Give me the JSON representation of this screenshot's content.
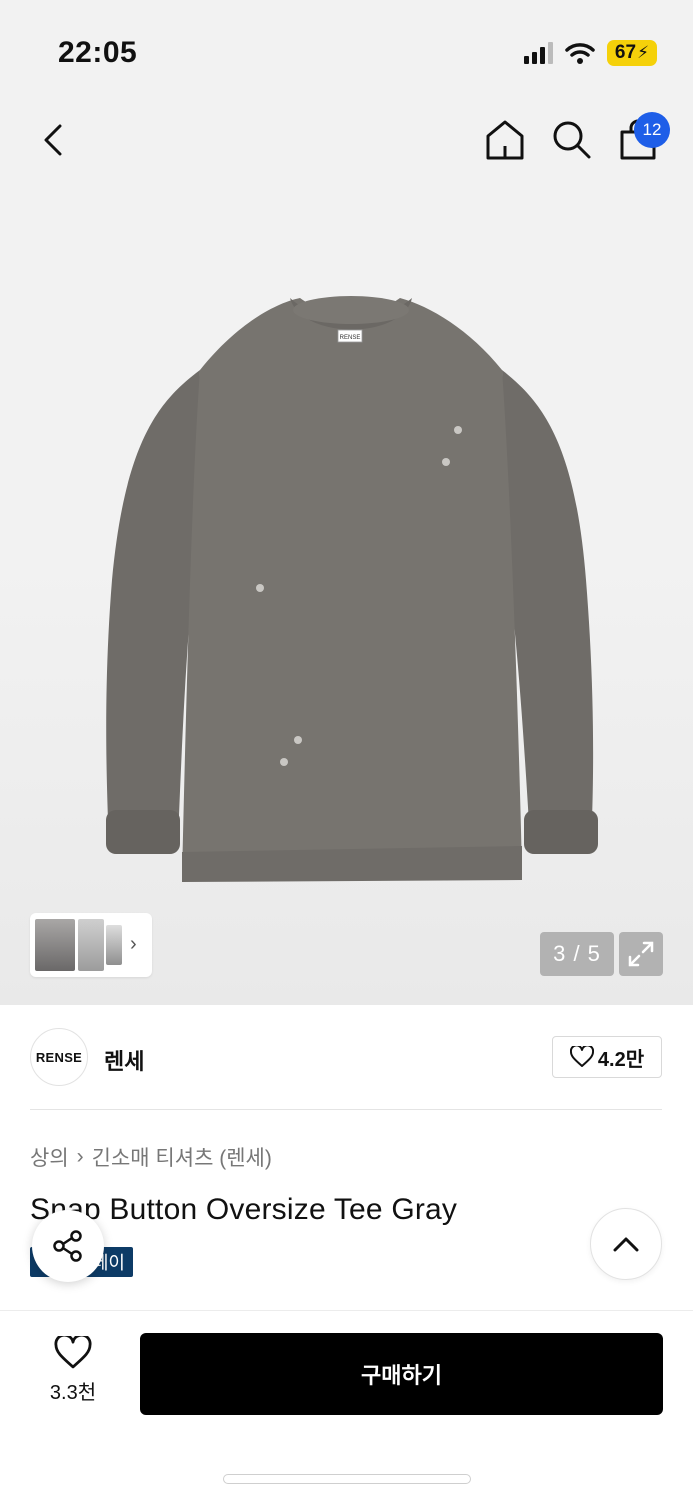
{
  "status_bar": {
    "time": "22:05",
    "battery": "67",
    "icons": [
      "signal-icon",
      "wifi-icon",
      "battery-charging-icon"
    ]
  },
  "nav": {
    "icons": [
      "back-icon",
      "home-icon",
      "search-icon",
      "shopping-bag-icon"
    ],
    "cart_badge": "12"
  },
  "gallery": {
    "counter": "3 / 5",
    "brand_label_on_shirt": "RENSE"
  },
  "brand": {
    "logo_text": "RENSE",
    "name": "렌세",
    "likes": "4.2만"
  },
  "breadcrumb": {
    "category": "상의",
    "subcategory": "긴소매 티셔츠 (렌세)"
  },
  "product": {
    "title": "Snap Button Oversize Tee Gray",
    "tag": "페이"
  },
  "bottom_bar": {
    "like_count": "3.3천",
    "buy_label": "구매하기"
  },
  "colors": {
    "badge_blue": "#1e5ee8",
    "tag_navy": "#0d3b66",
    "battery_yellow": "#f5d10a",
    "shirt_gray": "#76736f"
  }
}
